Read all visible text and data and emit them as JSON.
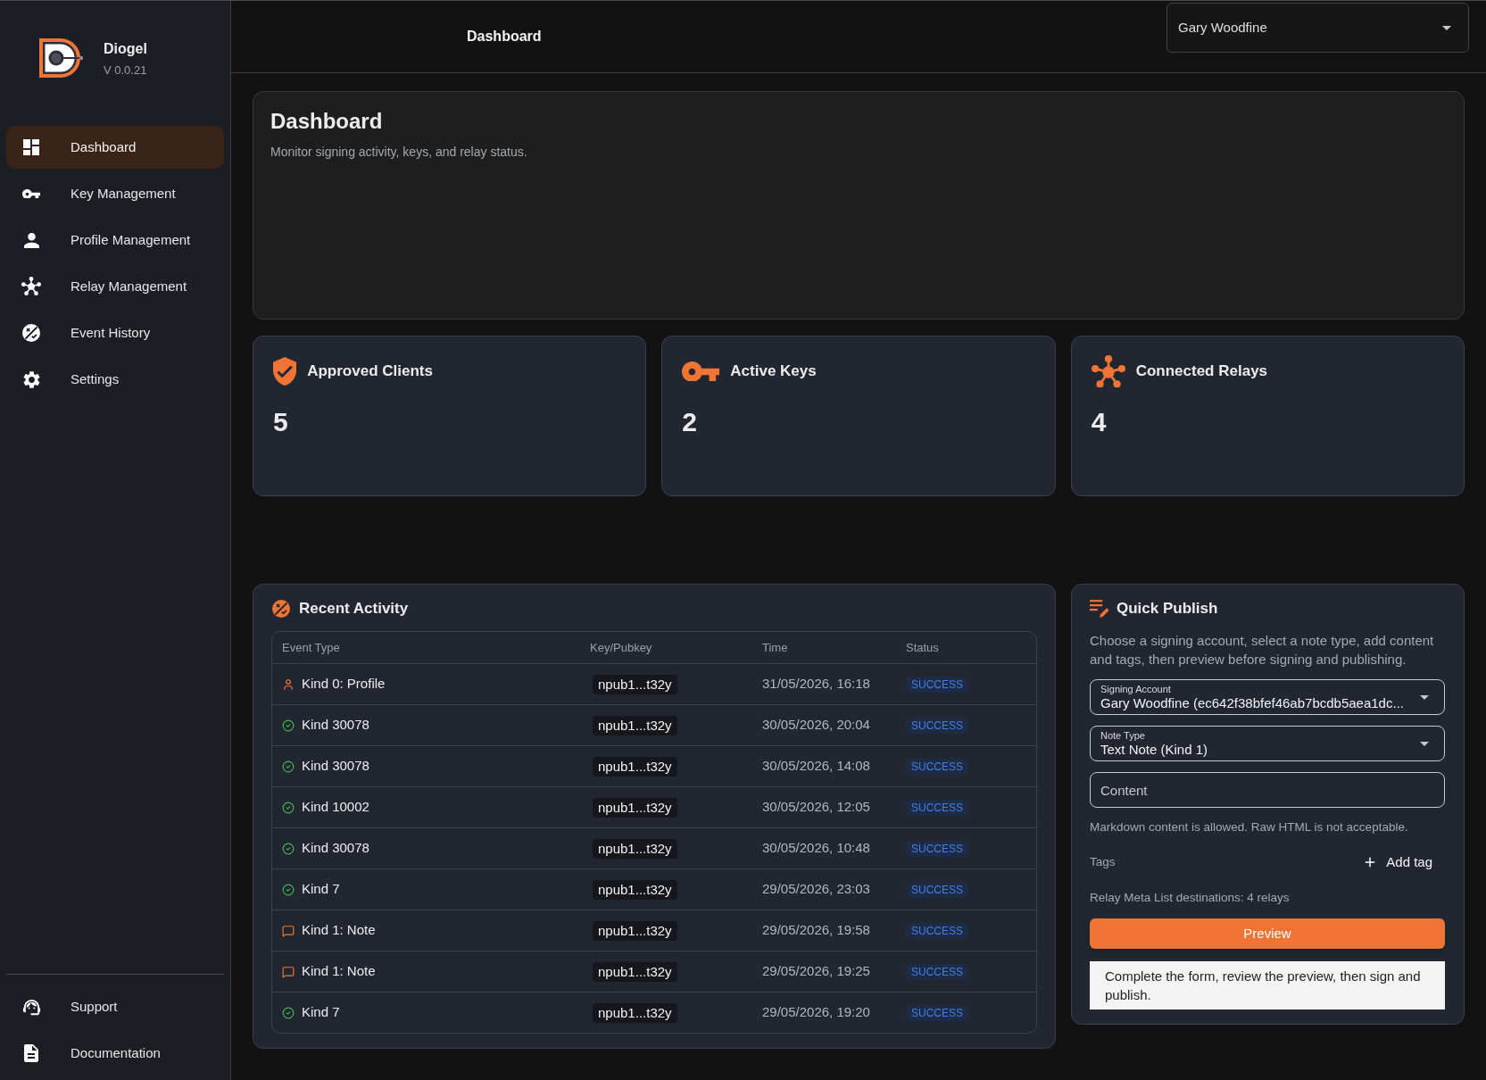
{
  "sidebar": {
    "app_name": "Diogel",
    "version": "V 0.0.21",
    "nav_items": [
      {
        "label": "Dashboard",
        "selected": true
      },
      {
        "label": "Key Management",
        "selected": false
      },
      {
        "label": "Profile Management",
        "selected": false
      },
      {
        "label": "Relay Management",
        "selected": false
      },
      {
        "label": "Event History",
        "selected": false
      },
      {
        "label": "Settings",
        "selected": false
      }
    ],
    "footer_items": [
      {
        "label": "Support",
        "selected": false
      },
      {
        "label": "Documentation",
        "selected": false
      }
    ]
  },
  "top_bar": {
    "title": "Dashboard",
    "account_select": {
      "value": "Gary Woodfine"
    }
  },
  "header_card": {
    "title": "Dashboard",
    "subtitle": "Monitor signing activity, keys, and relay status."
  },
  "stats": [
    {
      "label": "Approved Clients",
      "value": "5"
    },
    {
      "label": "Active Keys",
      "value": "2"
    },
    {
      "label": "Connected Relays",
      "value": "4"
    }
  ],
  "recent_activity": {
    "title": "Recent Activity",
    "table": {
      "columns": [
        "Event Type",
        "Key/Pubkey",
        "Time",
        "Status"
      ],
      "rows": [
        {
          "kind": "profile",
          "event_type": "Kind 0: Profile",
          "pubkey": "npub1...t32y",
          "time": "31/05/2026, 16:18",
          "status": "SUCCESS"
        },
        {
          "kind": "other",
          "event_type": "Kind 30078",
          "pubkey": "npub1...t32y",
          "time": "30/05/2026, 20:04",
          "status": "SUCCESS"
        },
        {
          "kind": "other",
          "event_type": "Kind 30078",
          "pubkey": "npub1...t32y",
          "time": "30/05/2026, 14:08",
          "status": "SUCCESS"
        },
        {
          "kind": "other",
          "event_type": "Kind 10002",
          "pubkey": "npub1...t32y",
          "time": "30/05/2026, 12:05",
          "status": "SUCCESS"
        },
        {
          "kind": "other",
          "event_type": "Kind 30078",
          "pubkey": "npub1...t32y",
          "time": "30/05/2026, 10:48",
          "status": "SUCCESS"
        },
        {
          "kind": "other",
          "event_type": "Kind 7",
          "pubkey": "npub1...t32y",
          "time": "29/05/2026, 23:03",
          "status": "SUCCESS"
        },
        {
          "kind": "note",
          "event_type": "Kind 1: Note",
          "pubkey": "npub1...t32y",
          "time": "29/05/2026, 19:58",
          "status": "SUCCESS"
        },
        {
          "kind": "note",
          "event_type": "Kind 1: Note",
          "pubkey": "npub1...t32y",
          "time": "29/05/2026, 19:25",
          "status": "SUCCESS"
        },
        {
          "kind": "other",
          "event_type": "Kind 7",
          "pubkey": "npub1...t32y",
          "time": "29/05/2026, 19:20",
          "status": "SUCCESS"
        }
      ]
    }
  },
  "quick_publish": {
    "title": "Quick Publish",
    "description": "Choose a signing account, select a note type, add content and tags, then preview before signing and publishing.",
    "signing_account": {
      "label": "Signing Account",
      "value": "Gary Woodfine (ec642f38bfef46ab7bcdb5aea1dc..."
    },
    "note_type": {
      "label": "Note Type",
      "value": "Text Note (Kind 1)"
    },
    "content": {
      "placeholder": "Content"
    },
    "helper": "Markdown content is allowed. Raw HTML is not acceptable.",
    "tags_label": "Tags",
    "add_tag": "Add tag",
    "relay_info": "Relay Meta List destinations: 4 relays",
    "preview_button": "Preview",
    "info": "Complete the form, review the preview, then sign and publish."
  }
}
